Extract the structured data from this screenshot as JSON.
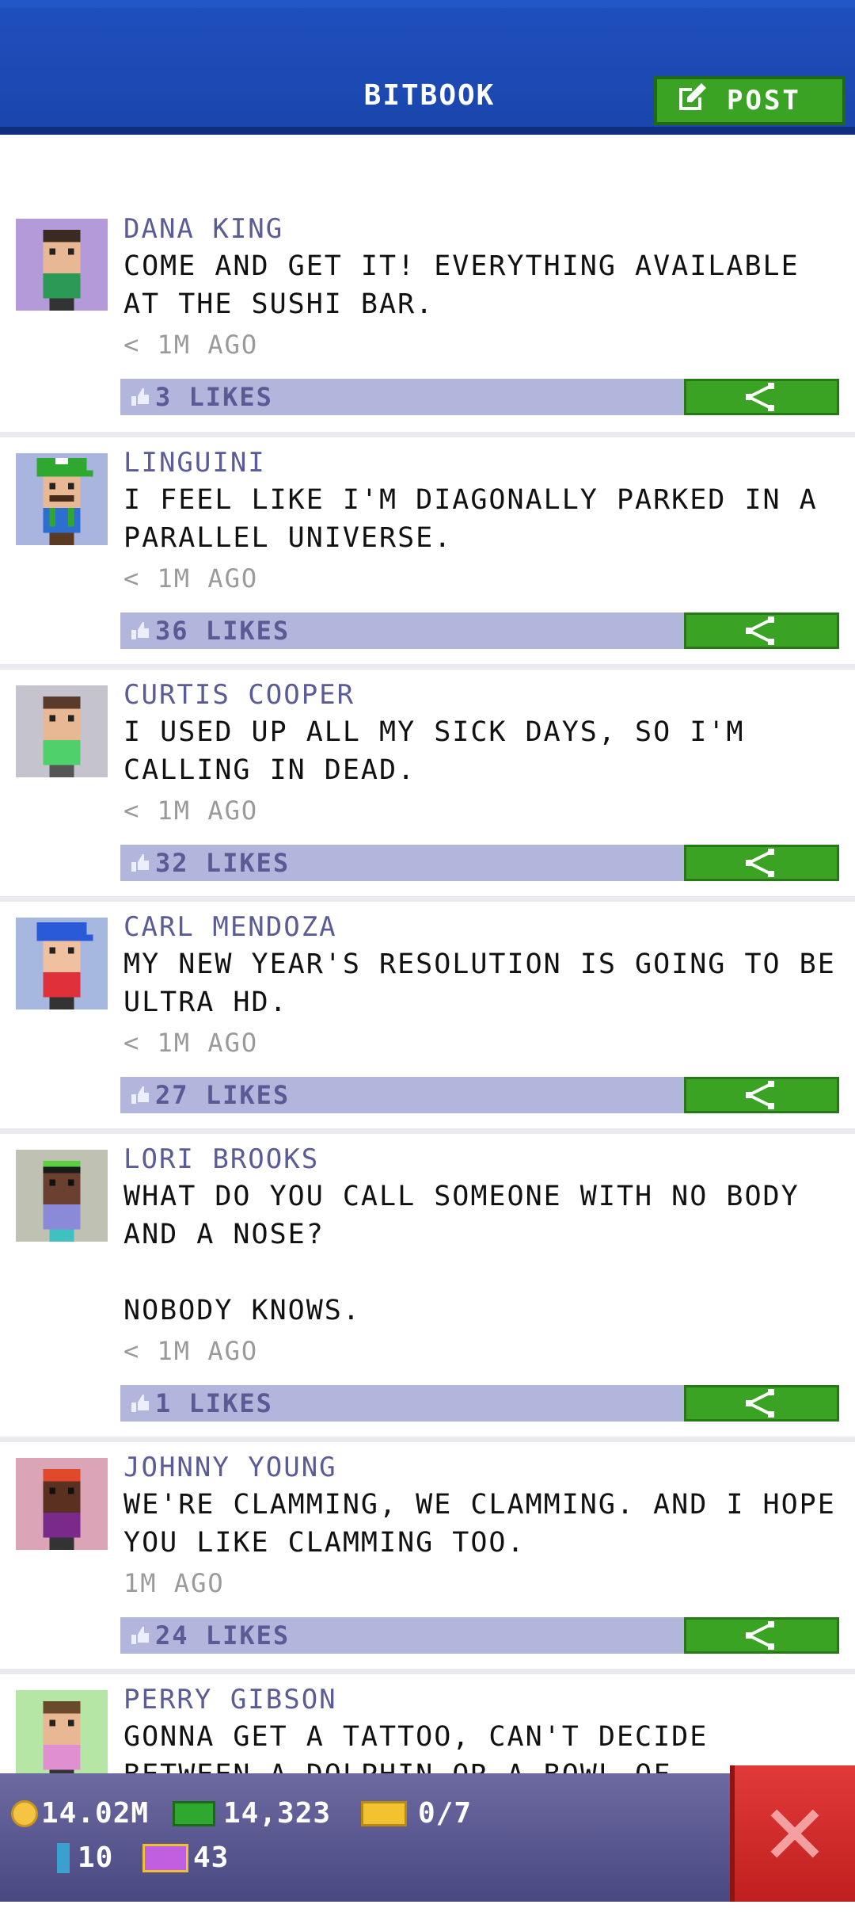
{
  "header": {
    "title": "BITBOOK",
    "post_label": "POST"
  },
  "posts": [
    {
      "name": "DANA KING",
      "text": "COME AND GET IT! EVERYTHING AVAILABLE AT THE SUSHI BAR.",
      "time": "< 1M AGO",
      "likes": "3 LIKES",
      "avatar_bg": "#b49ad8",
      "avatar_icon": "avatar-green-shirt-icon"
    },
    {
      "name": "LINGUINI",
      "text": "I FEEL LIKE I'M DIAGONALLY PARKED IN A PARALLEL UNIVERSE.",
      "time": "< 1M AGO",
      "likes": "36 LIKES",
      "avatar_bg": "#a9b5df",
      "avatar_icon": "avatar-green-cap-icon"
    },
    {
      "name": "CURTIS COOPER",
      "text": "I USED UP ALL MY SICK DAYS, SO I'M CALLING IN DEAD.",
      "time": "< 1M AGO",
      "likes": "32 LIKES",
      "avatar_bg": "#c5c3cd",
      "avatar_icon": "avatar-green-shirt-icon"
    },
    {
      "name": "CARL MENDOZA",
      "text": "MY NEW YEAR'S RESOLUTION IS GOING TO BE ULTRA HD.",
      "time": "< 1M AGO",
      "likes": "27 LIKES",
      "avatar_bg": "#a6b8e0",
      "avatar_icon": "avatar-blue-cap-icon"
    },
    {
      "name": "LORI BROOKS",
      "text": "WHAT DO YOU CALL SOMEONE WITH NO BODY AND A NOSE?\n\nNOBODY KNOWS.",
      "time": "< 1M AGO",
      "likes": "1 LIKES",
      "avatar_bg": "#bfc1b3",
      "avatar_icon": "avatar-purple-shirt-icon"
    },
    {
      "name": "JOHNNY YOUNG",
      "text": "WE'RE CLAMMING, WE CLAMMING. AND I HOPE YOU LIKE CLAMMING TOO.",
      "time": "1M AGO",
      "likes": "24 LIKES",
      "avatar_bg": "#dca4b7",
      "avatar_icon": "avatar-purple-jacket-icon"
    },
    {
      "name": "PERRY GIBSON",
      "text": "GONNA GET A TATTOO, CAN'T DECIDE BETWEEN A DOLPHIN OR A BOWL OF",
      "time": "",
      "likes": "",
      "avatar_bg": "#b6e6a6",
      "avatar_icon": "avatar-pink-shirt-icon"
    }
  ],
  "status": {
    "coins": "14.02M",
    "bux": "14,323",
    "tickets": "0/7",
    "keys": "10",
    "vip": "43"
  },
  "colors": {
    "header_blue": "#1a46ad",
    "accent_green": "#3aa324",
    "likes_bar": "#b3b6dc",
    "close_red": "#d22b2b"
  }
}
